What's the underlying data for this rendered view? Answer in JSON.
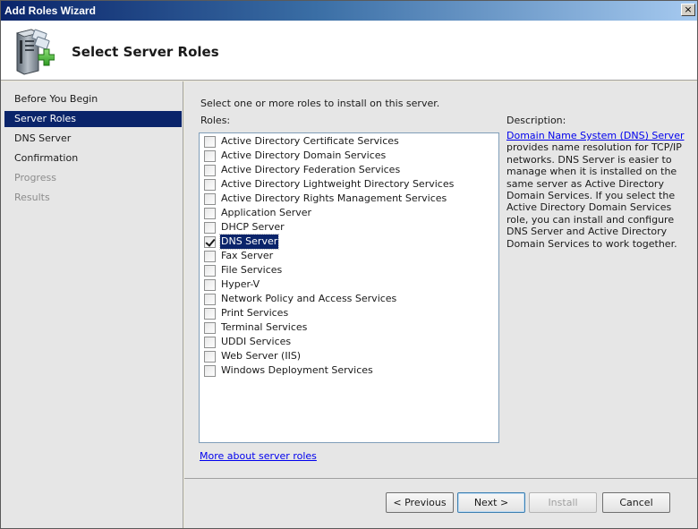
{
  "window": {
    "title": "Add Roles Wizard",
    "close_glyph": "×"
  },
  "header": {
    "title": "Select Server Roles",
    "icon": "server-add-icon"
  },
  "nav": {
    "items": [
      {
        "label": "Before You Begin",
        "state": "normal"
      },
      {
        "label": "Server Roles",
        "state": "active"
      },
      {
        "label": "DNS Server",
        "state": "normal"
      },
      {
        "label": "Confirmation",
        "state": "normal"
      },
      {
        "label": "Progress",
        "state": "disabled"
      },
      {
        "label": "Results",
        "state": "disabled"
      }
    ]
  },
  "main": {
    "instruction": "Select one or more roles to install on this server.",
    "roles_label": "Roles:",
    "roles": [
      {
        "label": "Active Directory Certificate Services",
        "checked": false
      },
      {
        "label": "Active Directory Domain Services",
        "checked": false
      },
      {
        "label": "Active Directory Federation Services",
        "checked": false
      },
      {
        "label": "Active Directory Lightweight Directory Services",
        "checked": false
      },
      {
        "label": "Active Directory Rights Management Services",
        "checked": false
      },
      {
        "label": "Application Server",
        "checked": false
      },
      {
        "label": "DHCP Server",
        "checked": false
      },
      {
        "label": "DNS Server",
        "checked": true,
        "selected": true
      },
      {
        "label": "Fax Server",
        "checked": false
      },
      {
        "label": "File Services",
        "checked": false
      },
      {
        "label": "Hyper-V",
        "checked": false
      },
      {
        "label": "Network Policy and Access Services",
        "checked": false
      },
      {
        "label": "Print Services",
        "checked": false
      },
      {
        "label": "Terminal Services",
        "checked": false
      },
      {
        "label": "UDDI Services",
        "checked": false
      },
      {
        "label": "Web Server (IIS)",
        "checked": false
      },
      {
        "label": "Windows Deployment Services",
        "checked": false
      }
    ],
    "more_link": "More about server roles",
    "description_label": "Description:",
    "description_link": "Domain Name System (DNS) Server",
    "description_text": " provides name resolution for TCP/IP networks. DNS Server is easier to manage when it is installed on the same server as Active Directory Domain Services. If you select the Active Directory Domain Services role, you can install and configure DNS Server and Active Directory Domain Services to work together."
  },
  "footer": {
    "previous": "< Previous",
    "next": "Next >",
    "install": "Install",
    "cancel": "Cancel"
  },
  "colors": {
    "title_bar_start": "#0a246a",
    "selection": "#0a246a",
    "link": "#0000ee",
    "panel": "#e6e6e6"
  }
}
